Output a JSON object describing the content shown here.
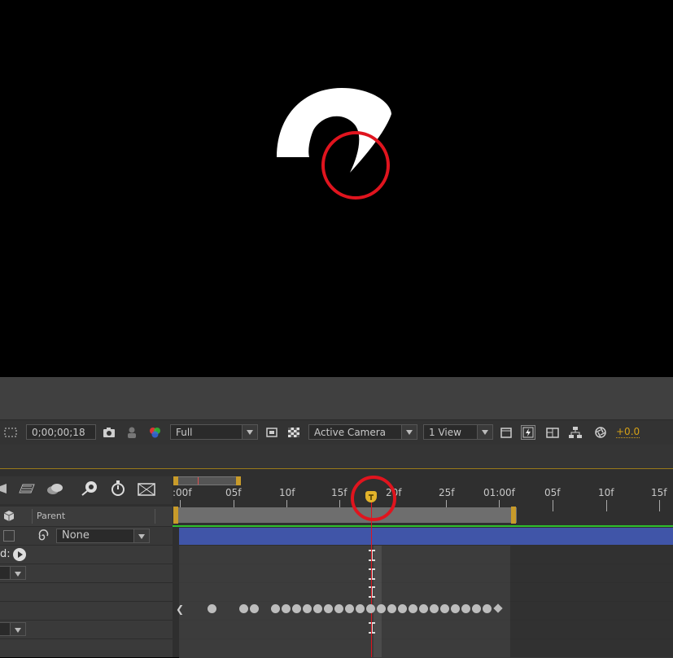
{
  "viewer_toolbar": {
    "timecode": "0;00;00;18",
    "resolution": "Full",
    "camera": "Active Camera",
    "views": "1 View",
    "exposure": "+0.0"
  },
  "timeline": {
    "ruler_labels": [
      ":00f",
      "05f",
      "10f",
      "15f",
      "20f",
      "25f",
      "01:00f",
      "05f",
      "10f",
      "15f"
    ],
    "parent_header": "Parent",
    "parent_value": "None",
    "layer_label_partial": "d:"
  },
  "annotations": {
    "highlight_color": "#e0141e"
  },
  "colors": {
    "layer_bar": "#4055a8",
    "playhead": "#e0141e",
    "work_area": "#c89b2a"
  }
}
